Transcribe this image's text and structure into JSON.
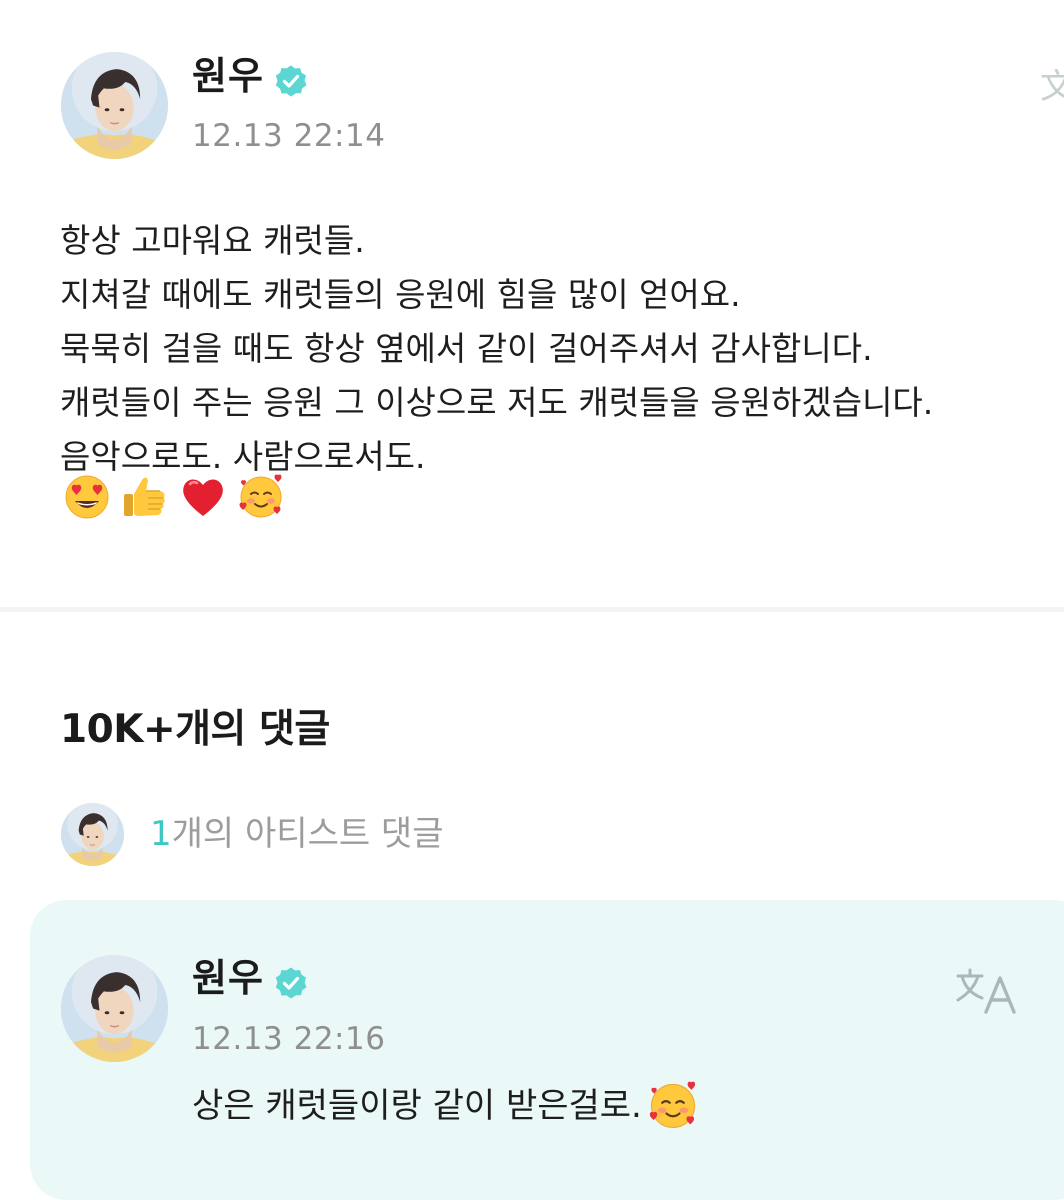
{
  "post": {
    "author": "원우",
    "timestamp": "12.13 22:14",
    "lines": [
      "항상 고마워요 캐럿들.",
      "지쳐갈 때에도 캐럿들의 응원에 힘을 많이 얻어요.",
      "묵묵히 걸을 때도 항상 옆에서 같이 걸어주셔서 감사합니다.",
      "캐럿들이 주는 응원 그 이상으로 저도 캐럿들을 응원하겠습니다.",
      "음악으로도. 사람으로서도."
    ],
    "emojis": [
      "heart-eyes-emoji",
      "thumbs-up-emoji",
      "red-heart-emoji",
      "smiling-face-with-hearts-emoji"
    ]
  },
  "comments": {
    "count_label": "10K+개의 댓글",
    "artist_comments": {
      "count": "1",
      "label": "개의 아티스트 댓글"
    },
    "featured": {
      "author": "원우",
      "timestamp": "12.13 22:16",
      "text": "상은 캐럿들이랑 같이 받은걸로.",
      "emoji": "smiling-face-with-hearts-emoji"
    }
  },
  "colors": {
    "accent": "#3fc7c3",
    "verified_badge": "#5cd6d3",
    "muted_text": "#8f8f8f",
    "card_background": "#eaf8f7",
    "translate_icon": "#aab8b8"
  },
  "icons": {
    "verified": "verified-badge-icon",
    "translate": "translate-icon"
  }
}
